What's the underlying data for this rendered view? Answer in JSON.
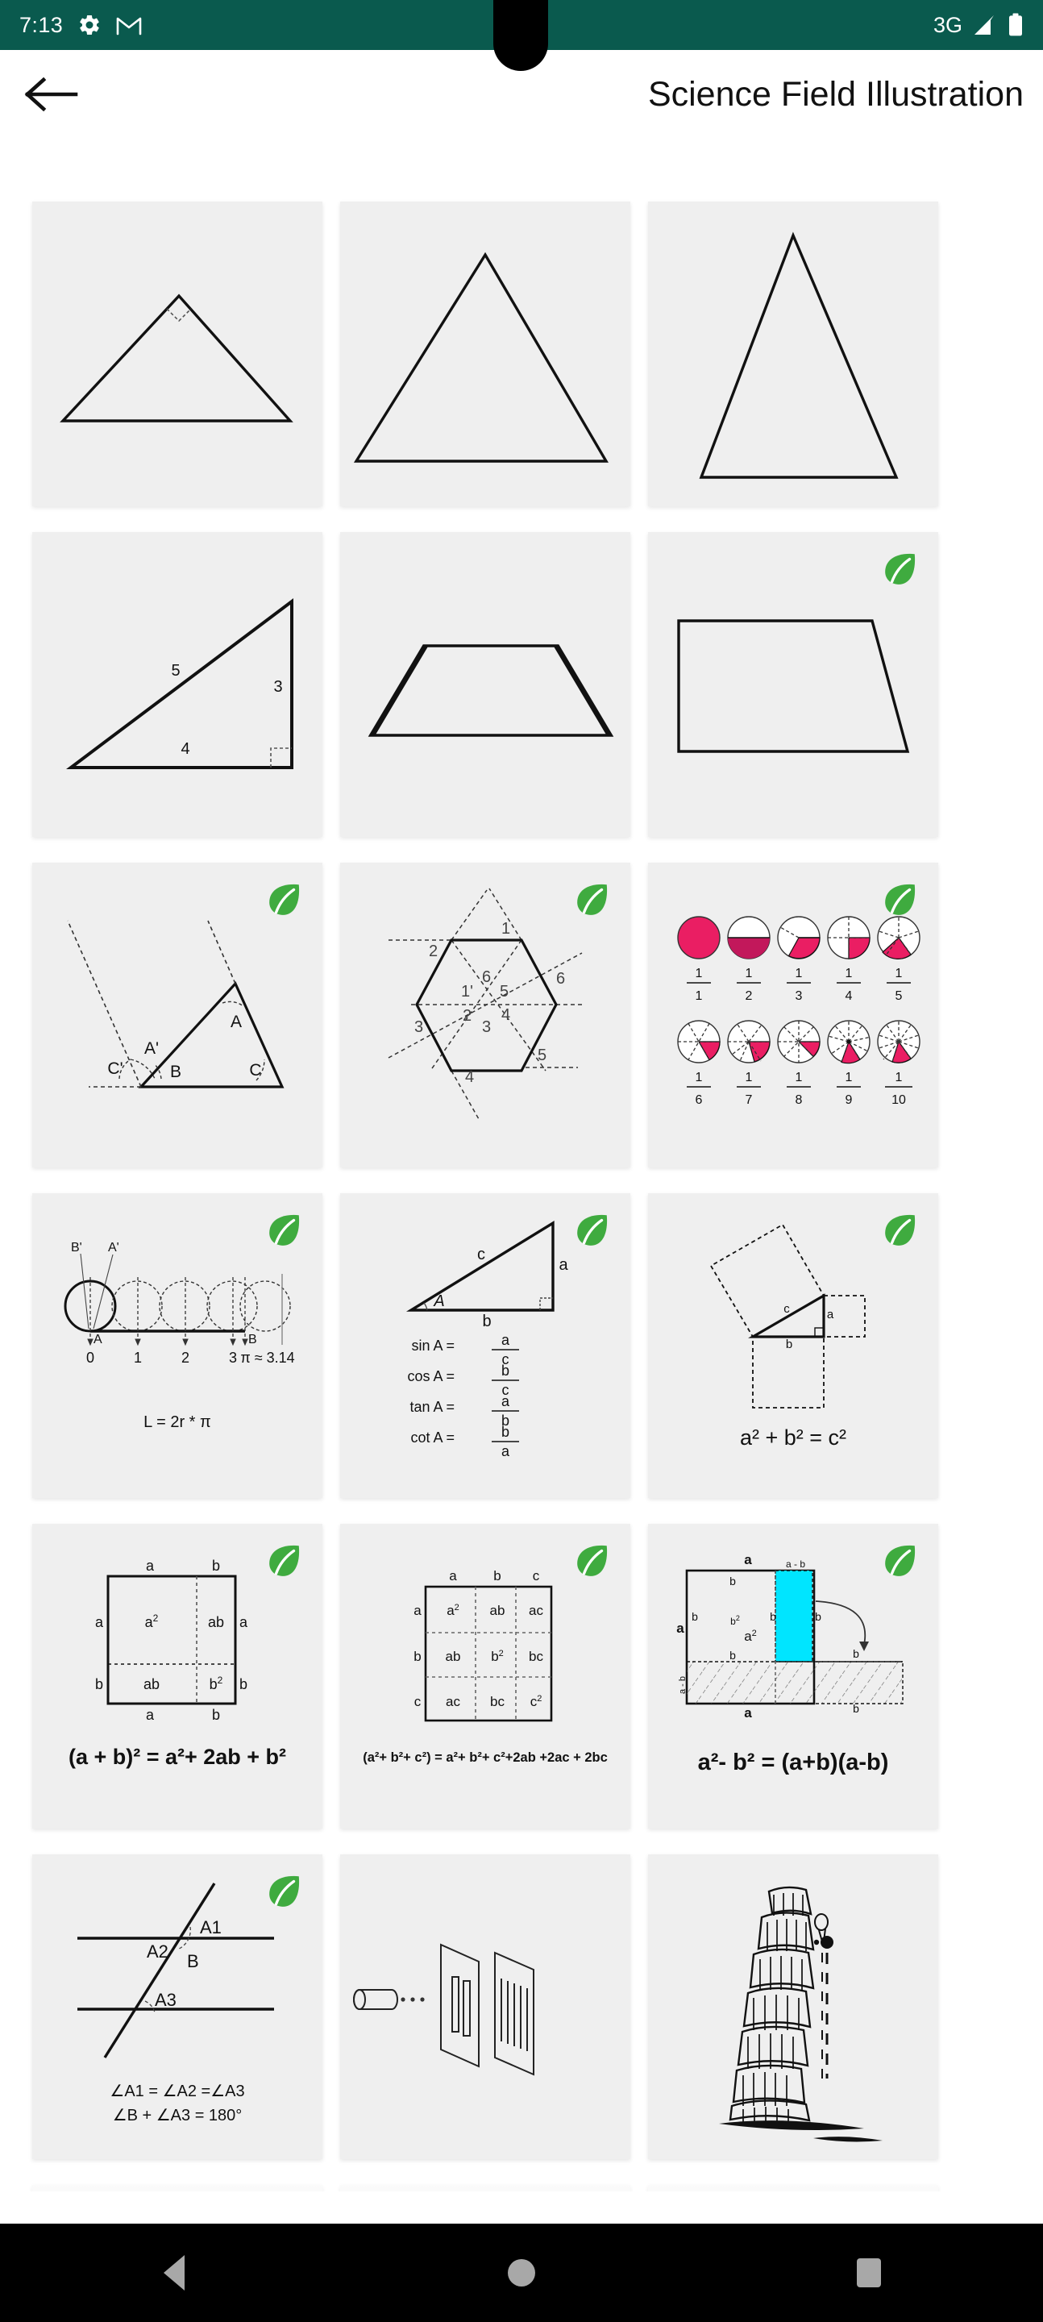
{
  "status_bar": {
    "time": "7:13",
    "network": "3G",
    "icons": [
      "gear-icon",
      "gmail-icon",
      "signal-icon",
      "battery-icon"
    ],
    "background_color": "#0a5a4e"
  },
  "app_bar": {
    "back_icon": "back-arrow-icon",
    "title": "Science Field Illustration"
  },
  "badge": {
    "icon": "leaf-icon",
    "color": "#3fab3f"
  },
  "accent_colors": {
    "pink": "#ea1e63",
    "pink_dark": "#c2185b",
    "cyan": "#00e5ff",
    "leaf_green": "#3fab3f"
  },
  "cards": [
    {
      "id": "obtuse-right-triangle",
      "row": 1,
      "col": 1,
      "badge": false,
      "labels": []
    },
    {
      "id": "equilateral-triangle",
      "row": 1,
      "col": 2,
      "badge": false,
      "labels": []
    },
    {
      "id": "isosceles-tall-triangle",
      "row": 1,
      "col": 3,
      "badge": false,
      "labels": []
    },
    {
      "id": "right-triangle-345",
      "row": 2,
      "col": 1,
      "badge": false,
      "labels": [
        "5",
        "3",
        "4"
      ]
    },
    {
      "id": "isosceles-trapezoid",
      "row": 2,
      "col": 2,
      "badge": false,
      "labels": []
    },
    {
      "id": "right-trapezoid",
      "row": 2,
      "col": 3,
      "badge": true,
      "labels": []
    },
    {
      "id": "exterior-angles-triangle",
      "row": 3,
      "col": 1,
      "badge": true,
      "labels": [
        "A",
        "A'",
        "B",
        "C",
        "C'"
      ]
    },
    {
      "id": "hexagon-angles",
      "row": 3,
      "col": 2,
      "badge": true,
      "labels": [
        "1",
        "2",
        "3",
        "4",
        "5",
        "6",
        "1'",
        "2",
        "3",
        "4",
        "5",
        "6"
      ]
    },
    {
      "id": "fraction-circles",
      "row": 3,
      "col": 3,
      "badge": true,
      "labels": []
    },
    {
      "id": "circle-circumference",
      "row": 4,
      "col": 1,
      "badge": true,
      "labels": [
        "B'",
        "A'",
        "A",
        "B",
        "0",
        "1",
        "2",
        "3",
        "π ≈ 3.14"
      ],
      "caption": "L = 2r * π"
    },
    {
      "id": "trigonometry-ratios",
      "row": 4,
      "col": 2,
      "badge": true,
      "labels": [
        "c",
        "a",
        "A",
        "b"
      ],
      "formulas": [
        {
          "name": "sin A =",
          "num": "a",
          "den": "c"
        },
        {
          "name": "cos A =",
          "num": "b",
          "den": "c"
        },
        {
          "name": "tan A =",
          "num": "a",
          "den": "b"
        },
        {
          "name": "cot A =",
          "num": "b",
          "den": "a"
        }
      ]
    },
    {
      "id": "pythagorean-theorem",
      "row": 4,
      "col": 3,
      "badge": true,
      "labels": [
        "c",
        "a",
        "b"
      ],
      "caption": "a² + b² = c²"
    },
    {
      "id": "square-of-sum",
      "row": 5,
      "col": 1,
      "badge": true,
      "labels": [
        "a",
        "b",
        "a",
        "ab",
        "a",
        "b",
        "ab",
        "b²",
        "b",
        "a",
        "b"
      ],
      "caption": "(a + b)² =  a²+ 2ab + b²"
    },
    {
      "id": "square-of-trinomial",
      "row": 5,
      "col": 2,
      "badge": true,
      "grid_headers_top": [
        "a",
        "b",
        "c"
      ],
      "grid_headers_left": [
        "a",
        "b",
        "c"
      ],
      "grid_cells": [
        [
          "a²",
          "ab",
          "ac"
        ],
        [
          "ab",
          "b²",
          "bc"
        ],
        [
          "ac",
          "bc",
          "c²"
        ]
      ],
      "caption": "(a²+ b²+ c²)  = a²+ b²+ c²+2ab +2ac + 2bc"
    },
    {
      "id": "difference-of-squares",
      "row": 5,
      "col": 3,
      "badge": true,
      "labels": [
        "a",
        "a - b",
        "b",
        "b",
        "a²",
        "b",
        "b",
        "a - b",
        "b",
        "b",
        "a"
      ],
      "caption": "a²- b² =  (a+b)(a-b)"
    },
    {
      "id": "parallel-lines-angles",
      "row": 6,
      "col": 1,
      "badge": true,
      "labels": [
        "A1",
        "A2",
        "B",
        "A3"
      ],
      "caption_lines": [
        "∠A1 = ∠A2 =∠A3",
        "∠B + ∠A3 = 180°"
      ]
    },
    {
      "id": "light-diffraction",
      "row": 6,
      "col": 2,
      "badge": false,
      "labels": []
    },
    {
      "id": "leaning-tower-of-pisa",
      "row": 6,
      "col": 3,
      "badge": false,
      "labels": []
    }
  ],
  "fraction_circles": {
    "row1": [
      {
        "num": "1",
        "den": "1"
      },
      {
        "num": "1",
        "den": "2"
      },
      {
        "num": "1",
        "den": "3"
      },
      {
        "num": "1",
        "den": "4"
      },
      {
        "num": "1",
        "den": "5"
      }
    ],
    "row2": [
      {
        "num": "1",
        "den": "6"
      },
      {
        "num": "1",
        "den": "7"
      },
      {
        "num": "1",
        "den": "8"
      },
      {
        "num": "1",
        "den": "9"
      },
      {
        "num": "1",
        "den": "10"
      }
    ]
  },
  "nav_bar": {
    "background_color": "#000000",
    "buttons": [
      "back-triangle-icon",
      "home-circle-icon",
      "recents-square-icon"
    ]
  }
}
